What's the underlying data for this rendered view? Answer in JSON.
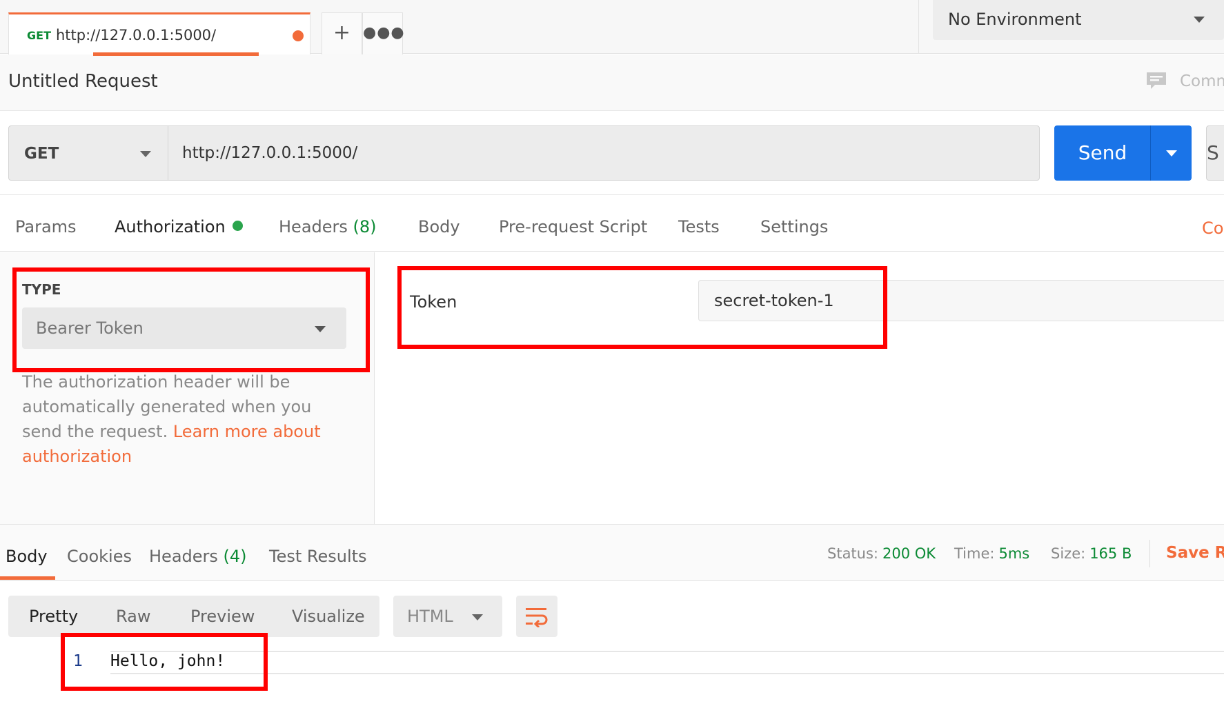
{
  "tab": {
    "method": "GET",
    "url": "http://127.0.0.1:5000/",
    "unsaved": true
  },
  "environment": {
    "selected": "No Environment"
  },
  "request": {
    "title": "Untitled Request",
    "comments_label": "Comm",
    "method": "GET",
    "url": "http://127.0.0.1:5000/",
    "send_label": "Send",
    "save_label": "S"
  },
  "request_tabs": [
    {
      "label": "Params"
    },
    {
      "label": "Authorization",
      "active": true
    },
    {
      "label": "Headers",
      "count": "(8)"
    },
    {
      "label": "Body"
    },
    {
      "label": "Pre-request Script"
    },
    {
      "label": "Tests"
    },
    {
      "label": "Settings"
    }
  ],
  "cookies_link": "Co",
  "auth": {
    "type_label": "TYPE",
    "type_value": "Bearer Token",
    "help_text": "The authorization header will be automatically generated when you send the request. ",
    "help_link": "Learn more about authorization",
    "token_label": "Token",
    "token_value": "secret-token-1"
  },
  "response_tabs": [
    {
      "label": "Body",
      "active": true
    },
    {
      "label": "Cookies"
    },
    {
      "label": "Headers",
      "count": "(4)"
    },
    {
      "label": "Test Results"
    }
  ],
  "response_meta": {
    "status_label": "Status:",
    "status_value": "200 OK",
    "time_label": "Time:",
    "time_value": "5ms",
    "size_label": "Size:",
    "size_value": "165 B",
    "save_label": "Save Re"
  },
  "view_modes": [
    "Pretty",
    "Raw",
    "Preview",
    "Visualize"
  ],
  "format": "HTML",
  "response_body": {
    "line_number": "1",
    "text": "Hello, john!"
  },
  "colors": {
    "accent": "#f26b3a",
    "send": "#1a74e8",
    "success": "#0b8a34",
    "annotation": "#ff0000"
  }
}
